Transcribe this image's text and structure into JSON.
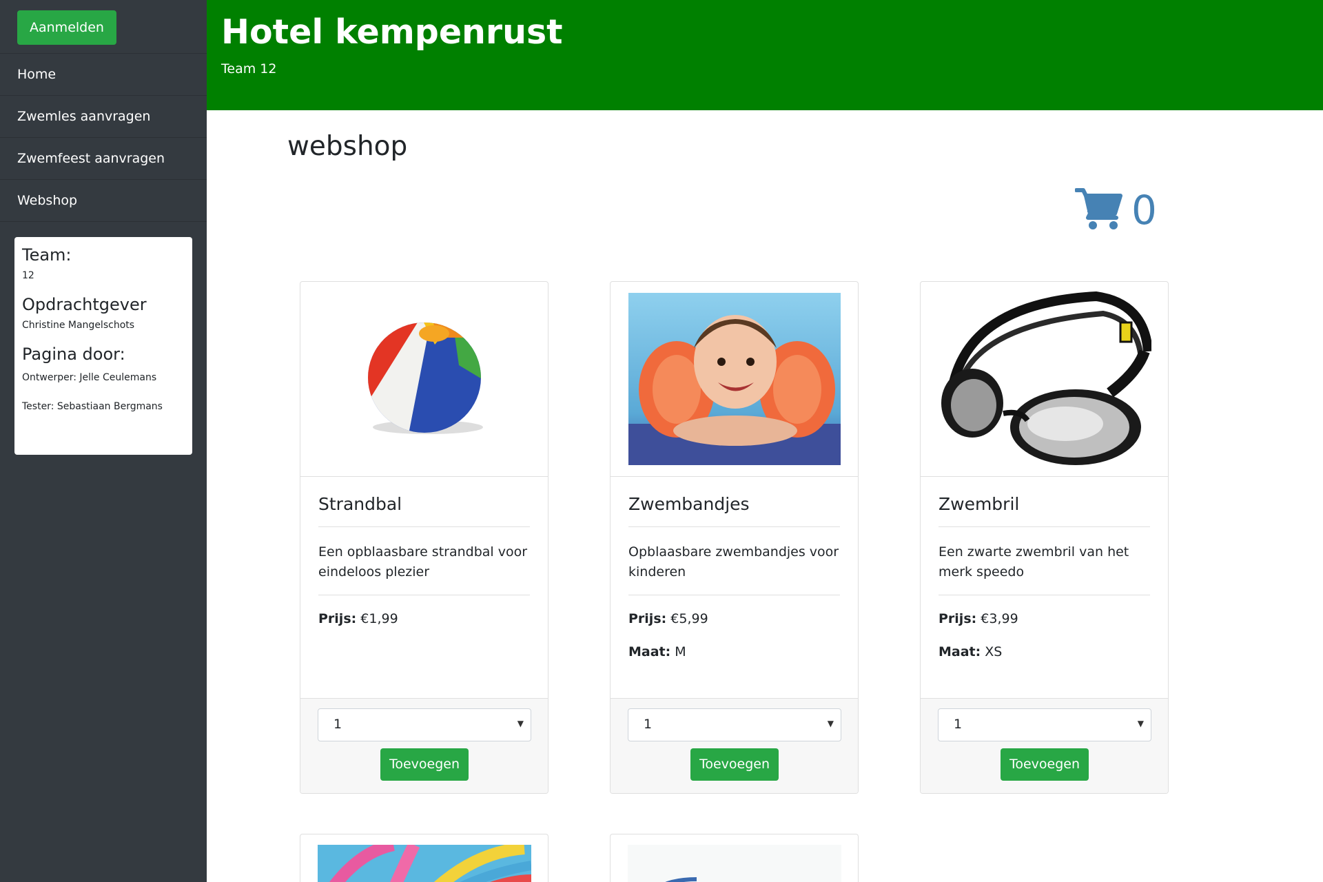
{
  "sidebar": {
    "login_label": "Aanmelden",
    "nav": [
      {
        "label": "Home"
      },
      {
        "label": "Zwemles aanvragen"
      },
      {
        "label": "Zwemfeest aanvragen"
      },
      {
        "label": "Webshop"
      }
    ],
    "info": {
      "team_heading": "Team:",
      "team_value": "12",
      "client_heading": "Opdrachtgever",
      "client_value": "Christine Mangelschots",
      "by_heading": "Pagina door:",
      "designer": "Ontwerper: Jelle Ceulemans",
      "tester": "Tester: Sebastiaan Bergmans"
    }
  },
  "header": {
    "title": "Hotel kempenrust",
    "subtitle": "Team 12"
  },
  "main": {
    "page_title": "webshop",
    "cart_count": "0",
    "products": [
      {
        "name": "Strandbal",
        "description": "Een opblaasbare strandbal voor eindeloos plezier",
        "price_label": "Prijs:",
        "price": "€1,99",
        "quantity": "1",
        "add_label": "Toevoegen",
        "image_icon": "beach-ball-image"
      },
      {
        "name": "Zwembandjes",
        "description": "Opblaasbare zwembandjes voor kinderen",
        "price_label": "Prijs:",
        "price": "€5,99",
        "size_label": "Maat:",
        "size": "M",
        "quantity": "1",
        "add_label": "Toevoegen",
        "image_icon": "armbands-image"
      },
      {
        "name": "Zwembril",
        "description": "Een zwarte zwembril van het merk speedo",
        "price_label": "Prijs:",
        "price": "€3,99",
        "size_label": "Maat:",
        "size": "XS",
        "quantity": "1",
        "add_label": "Toevoegen",
        "image_icon": "goggles-image"
      }
    ]
  },
  "colors": {
    "header_bg": "#008000",
    "sidebar_bg": "#343a40",
    "button_green": "#28a745",
    "cart_blue": "#4682b4"
  }
}
